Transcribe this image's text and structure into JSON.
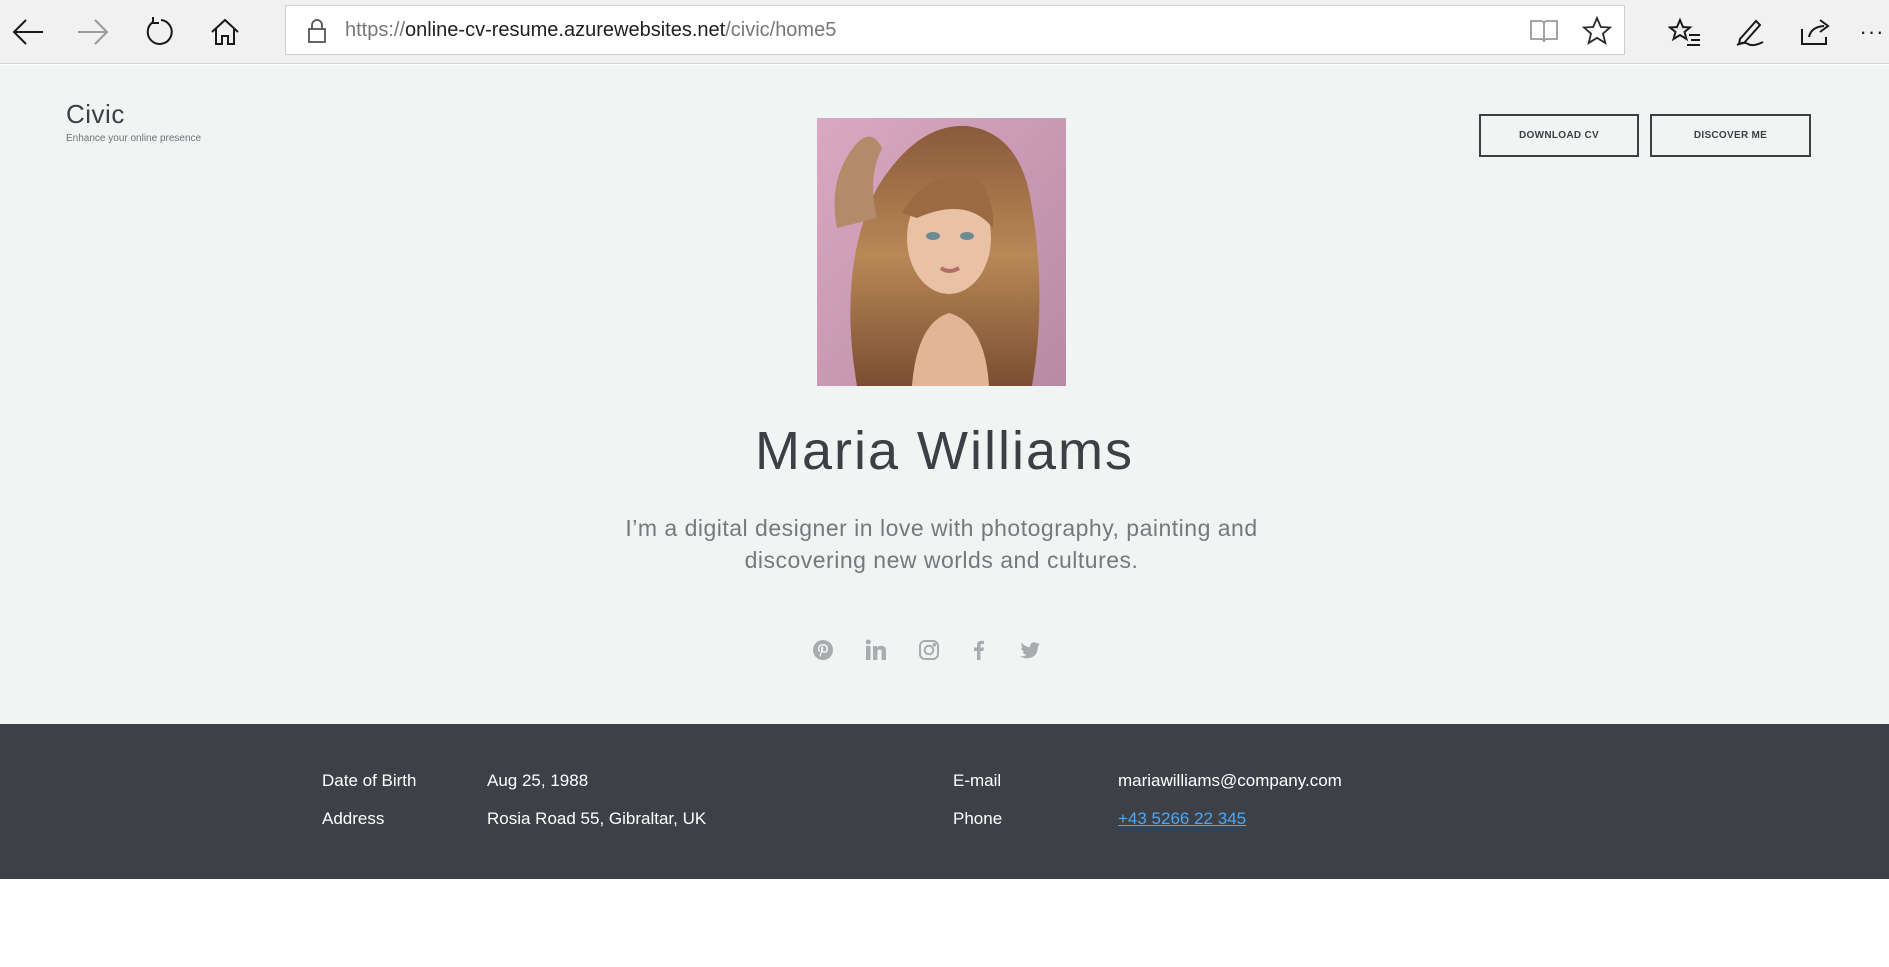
{
  "browser": {
    "url_prefix": "https://",
    "url_host": "online-cv-resume.azurewebsites.net",
    "url_path": "/civic/home5",
    "icons": [
      "back-icon",
      "forward-icon",
      "refresh-icon",
      "home-icon",
      "lock-icon",
      "reading-view-icon",
      "favorite-star-icon",
      "favorites-list-icon",
      "pen-notes-icon",
      "share-icon",
      "more-icon"
    ],
    "more_label": "···"
  },
  "brand": {
    "title": "Civic",
    "subtitle": "Enhance your online presence"
  },
  "header_buttons": {
    "download_label": "DOWNLOAD CV",
    "discover_label": "DISCOVER ME"
  },
  "profile": {
    "name": "Maria Williams",
    "tagline_line1": "I’m a digital designer in love with photography, painting and",
    "tagline_line2": "discovering new worlds and cultures."
  },
  "socials": [
    "pinterest-icon",
    "linkedin-icon",
    "instagram-icon",
    "facebook-icon",
    "twitter-icon"
  ],
  "info": {
    "dob_label": "Date of Birth",
    "dob_value": "Aug 25, 1988",
    "address_label": "Address",
    "address_value": "Rosia Road 55, Gibraltar, UK",
    "email_label": "E-mail",
    "email_value": "mariawilliams@company.com",
    "phone_label": "Phone",
    "phone_value": "+43 5266 22 345"
  },
  "colors": {
    "page_bg": "#f0f5f4",
    "dark": "#3d4047",
    "link": "#4ea6f2",
    "muted_text": "#76787c"
  }
}
